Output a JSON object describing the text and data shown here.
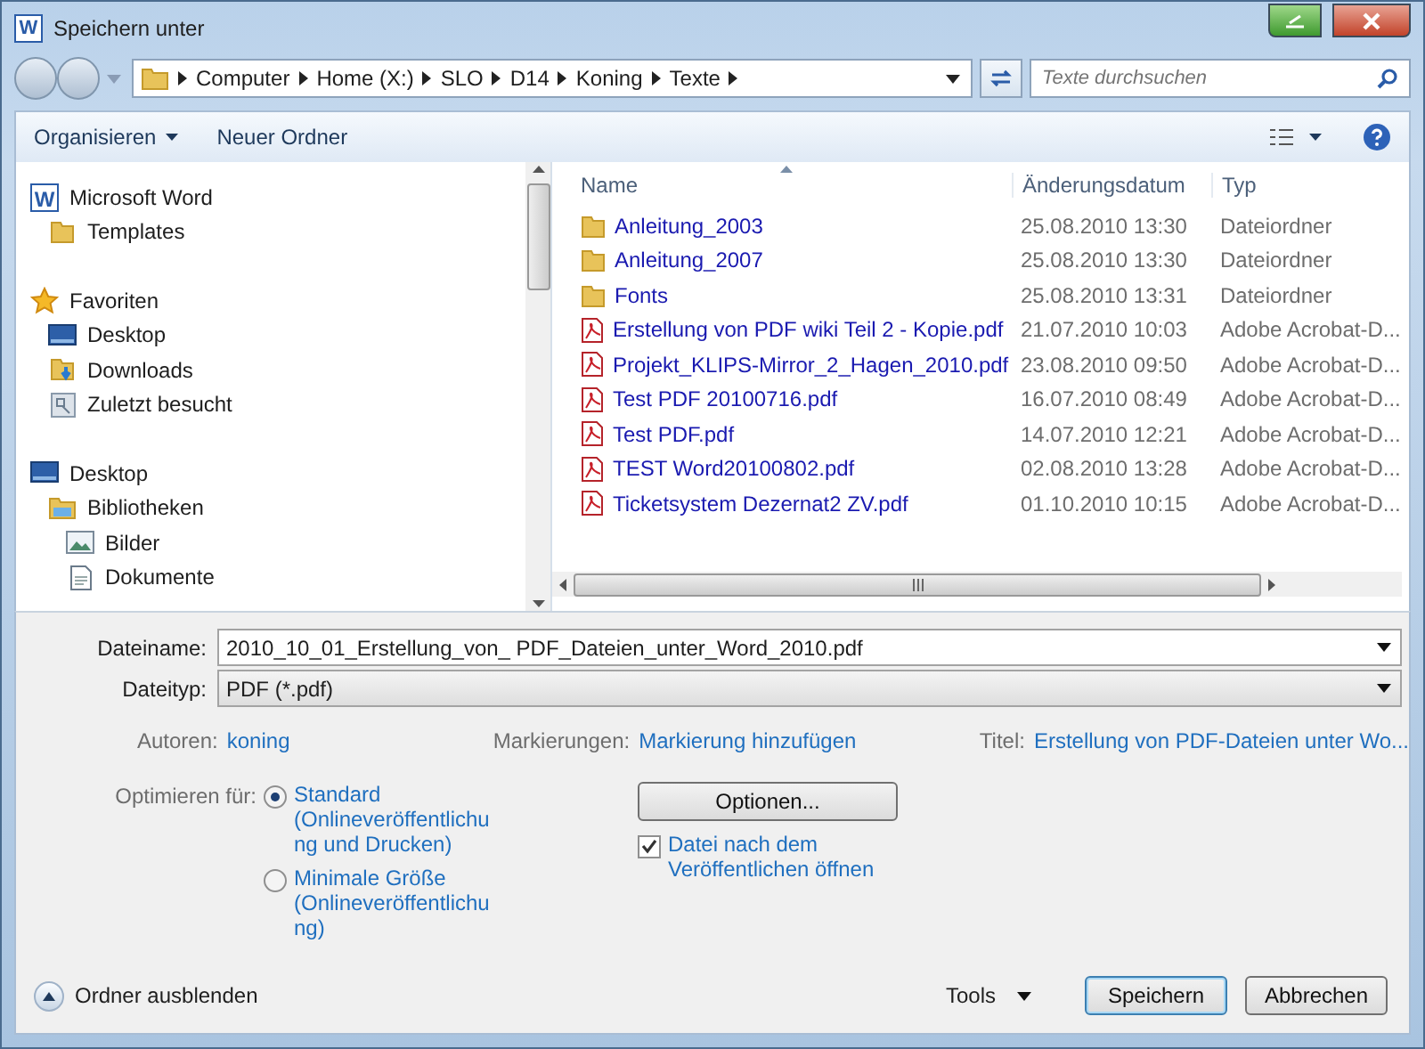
{
  "window": {
    "title": "Speichern unter",
    "icon_text": "W"
  },
  "address": {
    "crumbs": [
      "Computer",
      "Home (X:)",
      "SLO",
      "D14",
      "Koning",
      "Texte"
    ]
  },
  "search": {
    "placeholder": "Texte durchsuchen"
  },
  "toolbar": {
    "organize": "Organisieren",
    "new_folder": "Neuer Ordner"
  },
  "nav": [
    {
      "label": "Microsoft Word",
      "kind": "word",
      "icon_text": "W",
      "children": [
        {
          "label": "Templates",
          "kind": "folder"
        }
      ]
    },
    {
      "label": "Favoriten",
      "kind": "star",
      "children": [
        {
          "label": "Desktop",
          "kind": "desktop"
        },
        {
          "label": "Downloads",
          "kind": "downloads"
        },
        {
          "label": "Zuletzt besucht",
          "kind": "recent"
        }
      ]
    },
    {
      "label": "Desktop",
      "kind": "desktop",
      "children": [
        {
          "label": "Bibliotheken",
          "kind": "library",
          "children": [
            {
              "label": "Bilder",
              "kind": "pictures"
            },
            {
              "label": "Dokumente",
              "kind": "document"
            }
          ]
        }
      ]
    }
  ],
  "table": {
    "columns": [
      "Name",
      "Änderungsdatum",
      "Typ"
    ],
    "rows": [
      {
        "kind": "folder",
        "name": "Anleitung_2003",
        "date": "25.08.2010 13:30",
        "type": "Dateiordner"
      },
      {
        "kind": "folder",
        "name": "Anleitung_2007",
        "date": "25.08.2010 13:30",
        "type": "Dateiordner"
      },
      {
        "kind": "folder",
        "name": "Fonts",
        "date": "25.08.2010 13:31",
        "type": "Dateiordner"
      },
      {
        "kind": "pdf",
        "name": "Erstellung von PDF wiki Teil 2 - Kopie.pdf",
        "date": "21.07.2010 10:03",
        "type": "Adobe Acrobat-D..."
      },
      {
        "kind": "pdf",
        "name": "Projekt_KLIPS-Mirror_2_Hagen_2010.pdf",
        "date": "23.08.2010 09:50",
        "type": "Adobe Acrobat-D..."
      },
      {
        "kind": "pdf",
        "name": "Test PDF 20100716.pdf",
        "date": "16.07.2010 08:49",
        "type": "Adobe Acrobat-D..."
      },
      {
        "kind": "pdf",
        "name": "Test PDF.pdf",
        "date": "14.07.2010 12:21",
        "type": "Adobe Acrobat-D..."
      },
      {
        "kind": "pdf",
        "name": "TEST Word20100802.pdf",
        "date": "02.08.2010 13:28",
        "type": "Adobe Acrobat-D..."
      },
      {
        "kind": "pdf",
        "name": "Ticketsystem Dezernat2 ZV.pdf",
        "date": "01.10.2010 10:15",
        "type": "Adobe Acrobat-D..."
      }
    ]
  },
  "filename": {
    "label": "Dateiname:",
    "value": "2010_10_01_Erstellung_von_ PDF_Dateien_unter_Word_2010.pdf"
  },
  "filetype": {
    "label": "Dateityp:",
    "value": "PDF (*.pdf)"
  },
  "meta": [
    {
      "label": "Autoren:",
      "value": "koning"
    },
    {
      "label": "Markierungen:",
      "value": "Markierung hinzufügen"
    },
    {
      "label": "Titel:",
      "value": "Erstellung von PDF-Dateien unter Wo..."
    }
  ],
  "optimize": {
    "label": "Optimieren für:",
    "options": [
      {
        "label": "Standard (Onlineveröffentlichung und Drucken)",
        "selected": true
      },
      {
        "label": "Minimale Größe (Onlineveröffentlichung)",
        "selected": false
      }
    ]
  },
  "options_button": "Optionen...",
  "open_after": {
    "label": "Datei nach dem Veröffentlichen öffnen",
    "checked": true
  },
  "footer": {
    "hide_folders": "Ordner ausblenden",
    "tools": "Tools",
    "save": "Speichern",
    "cancel": "Abbrechen"
  }
}
